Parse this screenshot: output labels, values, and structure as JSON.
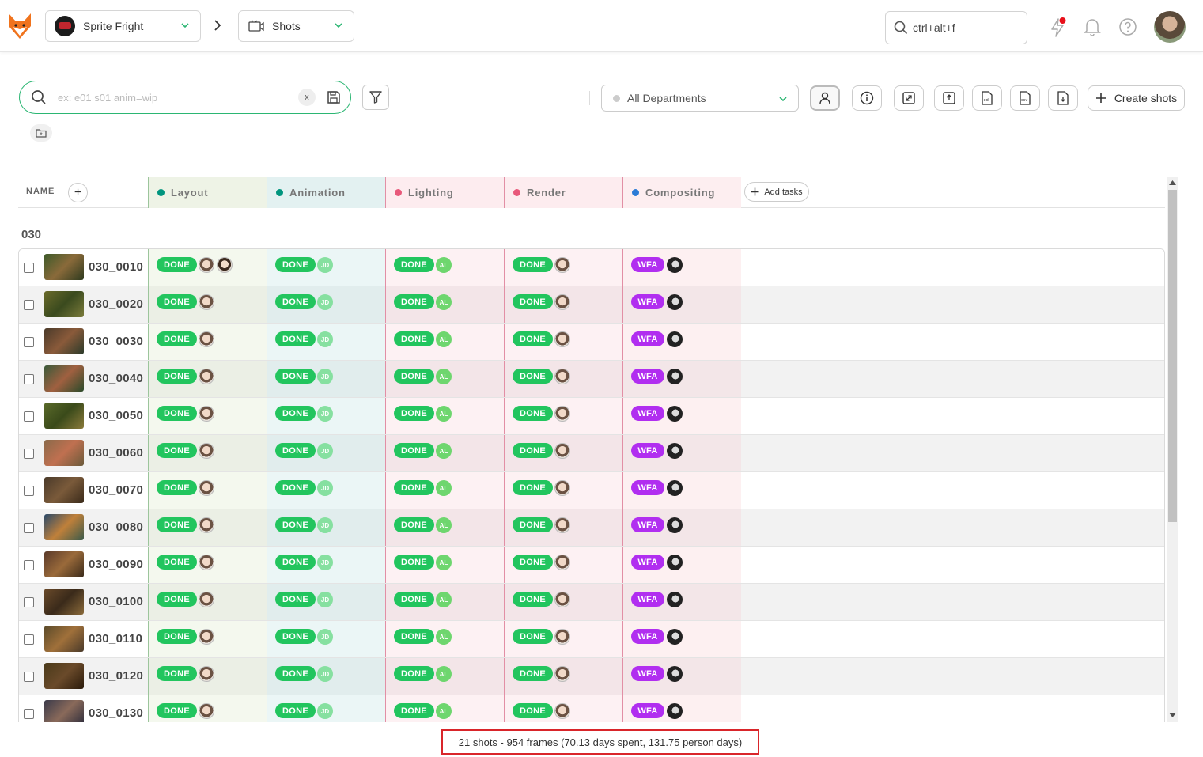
{
  "topbar": {
    "production": "Sprite Fright",
    "section": "Shots",
    "global_search_placeholder": "ctrl+alt+f"
  },
  "toolbar": {
    "search_placeholder": "ex: e01 s01 anim=wip",
    "clear_label": "x",
    "department_select": "All Departments",
    "create_label": "Create shots"
  },
  "table": {
    "name_header": "NAME",
    "add_tasks_label": "Add tasks",
    "sequence": "030",
    "columns": [
      {
        "name": "Layout",
        "color": "#00957e"
      },
      {
        "name": "Animation",
        "color": "#00957e"
      },
      {
        "name": "Lighting",
        "color": "#e8587a"
      },
      {
        "name": "Render",
        "color": "#e8587a"
      },
      {
        "name": "Compositing",
        "color": "#2b7bd6"
      }
    ],
    "status_colors": {
      "DONE": "#22c55e",
      "WFA": "#b12ef0"
    },
    "assignee_initials": {
      "animation": "JD",
      "lighting": "AL"
    },
    "rows": [
      {
        "name": "030_0010",
        "layout": "DONE",
        "animation": "DONE",
        "lighting": "DONE",
        "render": "DONE",
        "compositing": "WFA"
      },
      {
        "name": "030_0020",
        "layout": "DONE",
        "animation": "DONE",
        "lighting": "DONE",
        "render": "DONE",
        "compositing": "WFA"
      },
      {
        "name": "030_0030",
        "layout": "DONE",
        "animation": "DONE",
        "lighting": "DONE",
        "render": "DONE",
        "compositing": "WFA"
      },
      {
        "name": "030_0040",
        "layout": "DONE",
        "animation": "DONE",
        "lighting": "DONE",
        "render": "DONE",
        "compositing": "WFA"
      },
      {
        "name": "030_0050",
        "layout": "DONE",
        "animation": "DONE",
        "lighting": "DONE",
        "render": "DONE",
        "compositing": "WFA"
      },
      {
        "name": "030_0060",
        "layout": "DONE",
        "animation": "DONE",
        "lighting": "DONE",
        "render": "DONE",
        "compositing": "WFA"
      },
      {
        "name": "030_0070",
        "layout": "DONE",
        "animation": "DONE",
        "lighting": "DONE",
        "render": "DONE",
        "compositing": "WFA"
      },
      {
        "name": "030_0080",
        "layout": "DONE",
        "animation": "DONE",
        "lighting": "DONE",
        "render": "DONE",
        "compositing": "WFA"
      },
      {
        "name": "030_0090",
        "layout": "DONE",
        "animation": "DONE",
        "lighting": "DONE",
        "render": "DONE",
        "compositing": "WFA"
      },
      {
        "name": "030_0100",
        "layout": "DONE",
        "animation": "DONE",
        "lighting": "DONE",
        "render": "DONE",
        "compositing": "WFA"
      },
      {
        "name": "030_0110",
        "layout": "DONE",
        "animation": "DONE",
        "lighting": "DONE",
        "render": "DONE",
        "compositing": "WFA"
      },
      {
        "name": "030_0120",
        "layout": "DONE",
        "animation": "DONE",
        "lighting": "DONE",
        "render": "DONE",
        "compositing": "WFA"
      },
      {
        "name": "030_0130",
        "layout": "DONE",
        "animation": "DONE",
        "lighting": "DONE",
        "render": "DONE",
        "compositing": "WFA"
      }
    ]
  },
  "footer": {
    "summary": "21 shots - 954 frames (70.13 days spent, 131.75 person days)"
  }
}
